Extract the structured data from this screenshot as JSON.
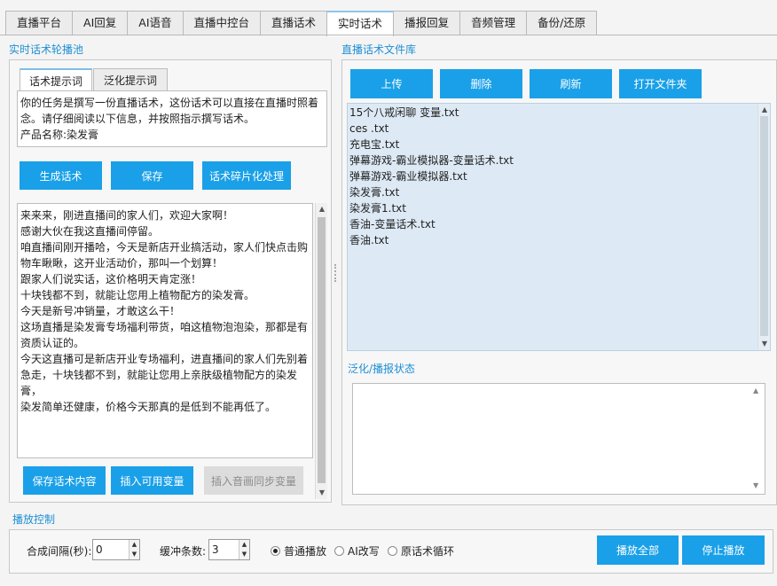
{
  "tabs": [
    "直播平台",
    "AI回复",
    "AI语音",
    "直播中控台",
    "直播话术",
    "实时话术",
    "播报回复",
    "音频管理",
    "备份/还原"
  ],
  "active_tab": "实时话术",
  "left": {
    "section_title": "实时话术轮播池",
    "subtabs": [
      "话术提示词",
      "泛化提示词"
    ],
    "prompt_text": "你的任务是撰写一份直播话术，这份话术可以直接在直播时照着念。请仔细阅读以下信息，并按照指示撰写话术。\n产品名称:染发膏",
    "buttons": {
      "generate": "生成话术",
      "save": "保存",
      "fragment": "话术碎片化处理"
    },
    "script_text": "来来来，刚进直播间的家人们，欢迎大家啊！\n感谢大伙在我这直播间停留。\n咱直播间刚开播哈，今天是新店开业搞活动，家人们快点击购物车瞅瞅，这开业活动价，那叫一个划算！\n跟家人们说实话，这价格明天肯定涨！\n十块钱都不到，就能让您用上植物配方的染发膏。\n今天是新号冲销量，才敢这么干！\n这场直播是染发膏专场福利带货，咱这植物泡泡染，那都是有资质认证的。\n今天这直播可是新店开业专场福利，进直播间的家人们先别着急走，十块钱都不到，就能让您用上亲肤级植物配方的染发膏，\n染发简单还健康，价格今天那真的是低到不能再低了。",
    "bottom_buttons": {
      "save_content": "保存话术内容",
      "insert_var": "插入可用变量",
      "insert_audio": "插入音画同步变量"
    }
  },
  "right": {
    "section_title": "直播话术文件库",
    "buttons": {
      "upload": "上传",
      "delete": "删除",
      "refresh": "刷新",
      "open_folder": "打开文件夹"
    },
    "files": [
      "15个八戒闲聊 变量.txt",
      "ces .txt",
      "充电宝.txt",
      "弹幕游戏-霸业模拟器-变量话术.txt",
      "弹幕游戏-霸业模拟器.txt",
      "染发膏.txt",
      "染发膏1.txt",
      "香油-变量话术.txt",
      "香油.txt"
    ],
    "status_title": "泛化/播报状态",
    "status_text": ""
  },
  "control": {
    "section_title": "播放控制",
    "interval_label": "合成间隔(秒):",
    "interval_value": "0",
    "buffer_label": "缓冲条数:",
    "buffer_value": "3",
    "radio_options": [
      "普通播放",
      "AI改写",
      "原话术循环"
    ],
    "radio_selected": 0,
    "play_all": "播放全部",
    "stop_play": "停止播放"
  }
}
